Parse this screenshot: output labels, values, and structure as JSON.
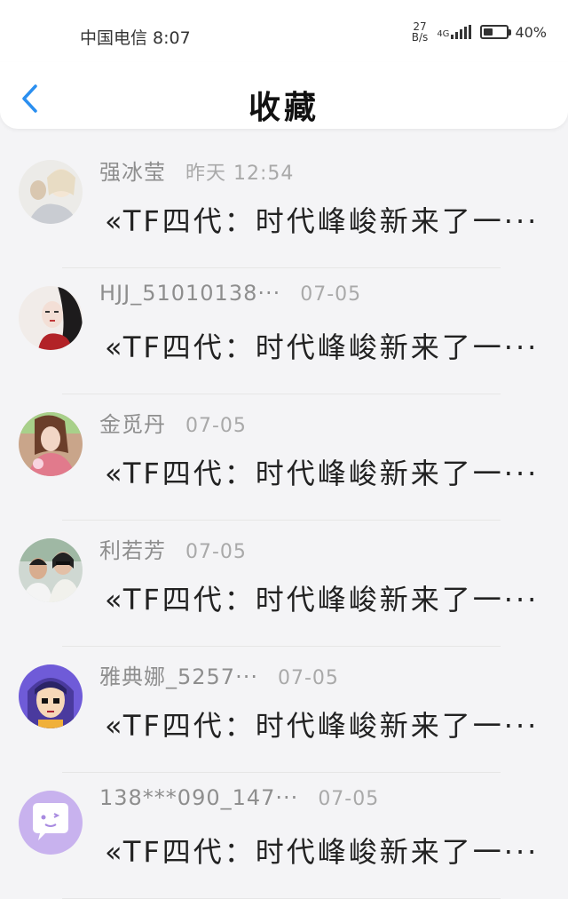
{
  "status_bar": {
    "carrier_time": "中国电信 8:07",
    "speed_value": "27",
    "speed_unit": "B/s",
    "network": "4G",
    "battery": "40%",
    "battery_level": 0.4
  },
  "header": {
    "title": "收藏",
    "back_icon": "chevron-left-icon",
    "accent_color": "#2b8ff0"
  },
  "items": [
    {
      "sender": "强冰莹",
      "time": "昨天 12:54",
      "preview": "«TF四代：时代峰峻新来了一···"
    },
    {
      "sender": "HJJ_51010138···",
      "time": "07-05",
      "preview": "«TF四代：时代峰峻新来了一···"
    },
    {
      "sender": "金觅丹",
      "time": "07-05",
      "preview": "«TF四代：时代峰峻新来了一···"
    },
    {
      "sender": "利若芳",
      "time": "07-05",
      "preview": "«TF四代：时代峰峻新来了一···"
    },
    {
      "sender": "雅典娜_5257···",
      "time": "07-05",
      "preview": "«TF四代：时代峰峻新来了一···"
    },
    {
      "sender": "138***090_147···",
      "time": "07-05",
      "preview": "«TF四代：时代峰峻新来了一···"
    }
  ]
}
